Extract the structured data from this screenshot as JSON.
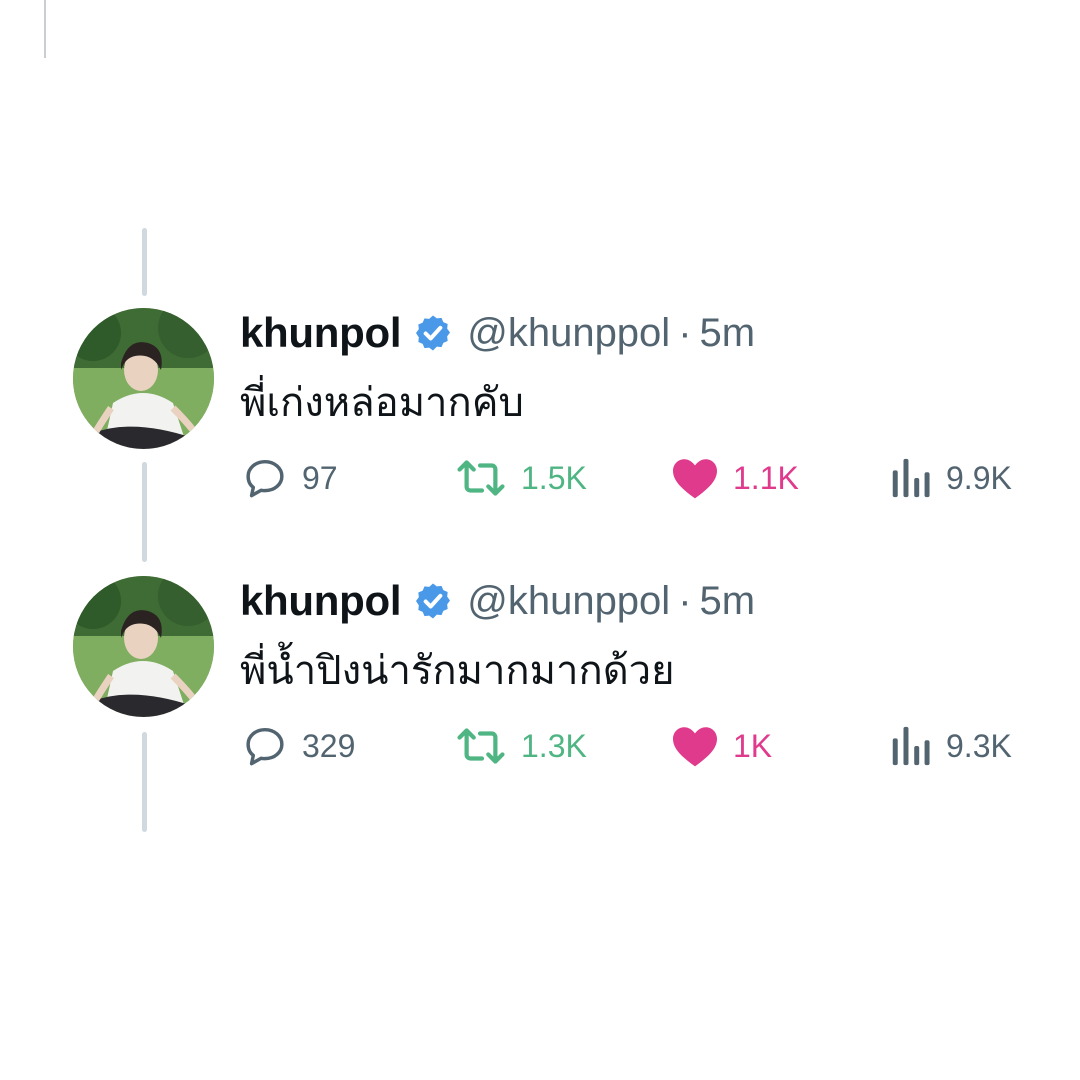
{
  "colors": {
    "text_primary": "#0f1419",
    "text_secondary": "#536471",
    "verified_blue": "#4a99e9",
    "retweet_green": "#4fb583",
    "like_pink": "#e03a8d",
    "thread_line": "#cfd9de"
  },
  "icons": {
    "reply": "speech-bubble-icon",
    "retweet": "retweet-arrows-icon",
    "like": "heart-icon",
    "views": "bar-chart-icon",
    "verified": "verified-badge-icon"
  },
  "tweets": [
    {
      "name": "khunpol",
      "handle": "@khunppol",
      "separator": "·",
      "time": "5m",
      "text": "พี่เก่งหล่อมากคับ",
      "replies": "97",
      "retweets": "1.5K",
      "likes": "1.1K",
      "views": "9.9K"
    },
    {
      "name": "khunpol",
      "handle": "@khunppol",
      "separator": "·",
      "time": "5m",
      "text": "พี่น้ำปิงน่ารักมากมากด้วย",
      "replies": "329",
      "retweets": "1.3K",
      "likes": "1K",
      "views": "9.3K"
    }
  ]
}
